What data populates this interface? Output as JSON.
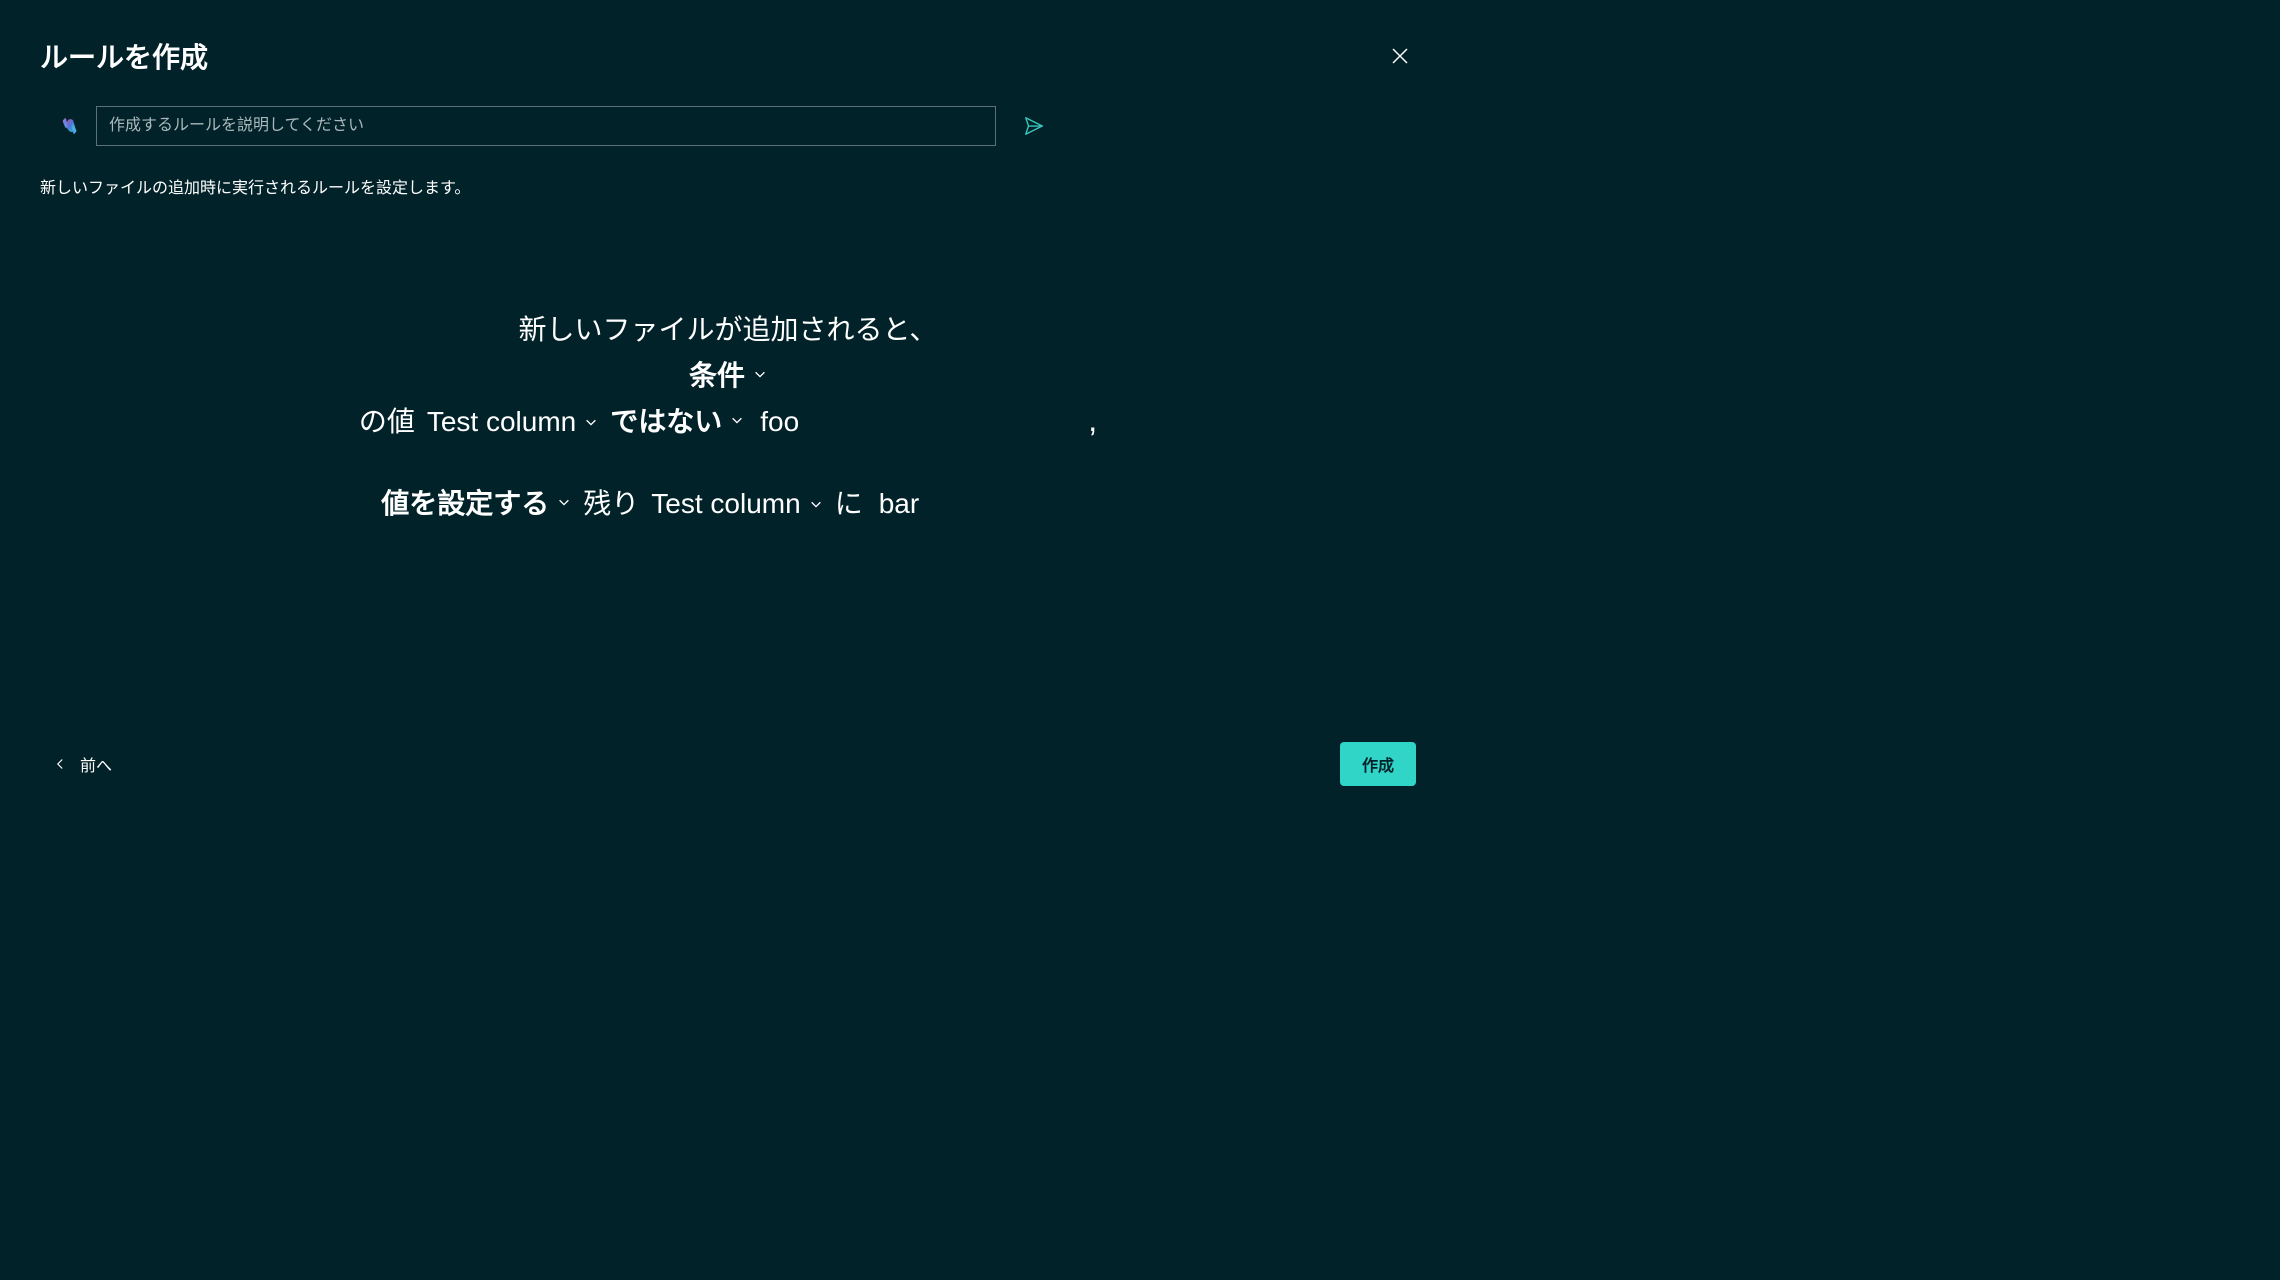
{
  "header": {
    "title": "ルールを作成"
  },
  "prompt": {
    "placeholder": "作成するルールを説明してください"
  },
  "description": "新しいファイルの追加時に実行されるルールを設定します。",
  "builder": {
    "trigger": "新しいファイルが追加されると、",
    "condition_label": "条件",
    "value_of_label": "の値",
    "condition_column": "Test column",
    "operator": "ではない",
    "condition_value": "foo",
    "comma": ",",
    "action_label": "値を設定する",
    "remaining_label": "残り",
    "action_column": "Test column",
    "to_label": "に",
    "action_value": "bar"
  },
  "footer": {
    "back_label": "前へ",
    "create_label": "作成"
  }
}
